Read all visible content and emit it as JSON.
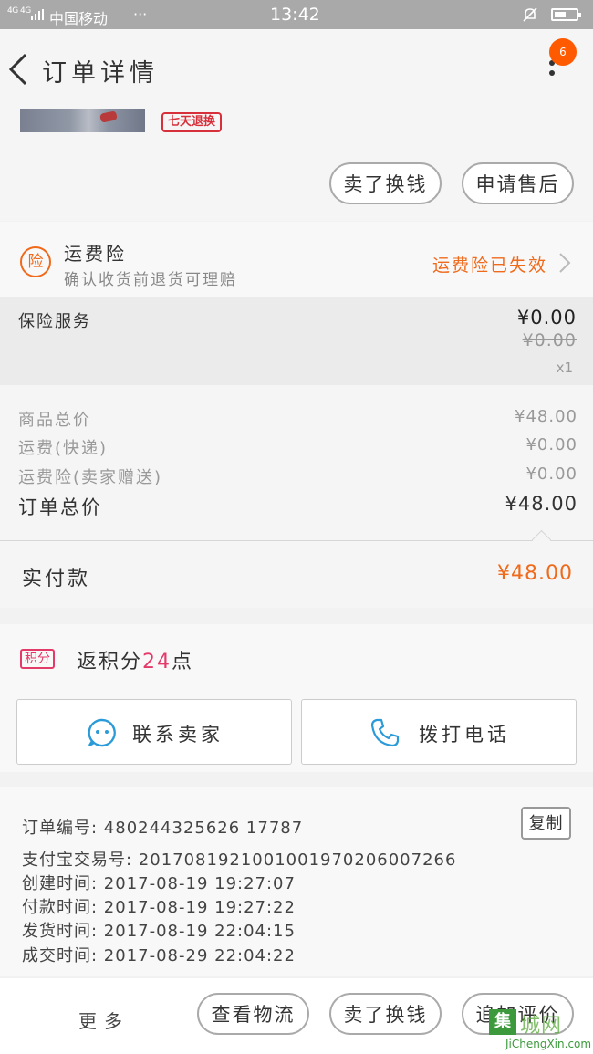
{
  "status_bar": {
    "signal": "4G 4G",
    "carrier": "中国移动",
    "dots": "···",
    "time": "13:42"
  },
  "header": {
    "title": "订单详情",
    "badge": "6"
  },
  "product": {
    "tag": "七天退换"
  },
  "actions_top": {
    "btn1": "卖了换钱",
    "btn2": "申请售后"
  },
  "insurance": {
    "icon_text": "险",
    "title": "运费险",
    "subtitle": "确认收货前退货可理赔",
    "status": "运费险已失效"
  },
  "insurance_service": {
    "label": "保险服务",
    "price": "¥0.00",
    "original_price": "¥0.00",
    "quantity": "x1"
  },
  "totals": {
    "rows": [
      {
        "label": "商品总价",
        "value": "¥48.00"
      },
      {
        "label": "运费(快递)",
        "value": "¥0.00"
      },
      {
        "label": "运费险(卖家赠送)",
        "value": "¥0.00"
      },
      {
        "label": "订单总价",
        "value": "¥48.00"
      }
    ],
    "paid_label": "实付款",
    "paid_value": "¥48.00"
  },
  "points": {
    "tag": "积分",
    "prefix": "返积分",
    "number": "24",
    "suffix": "点"
  },
  "contact": {
    "seller": "联系卖家",
    "phone": "拨打电话"
  },
  "order_info": {
    "lines": [
      "订单编号: 480244325626 17787",
      "支付宝交易号: 2017081921001001970206007266",
      "创建时间: 2017-08-19 19:27:07",
      "付款时间: 2017-08-19 19:27:22",
      "发货时间: 2017-08-19 22:04:15",
      "成交时间: 2017-08-29 22:04:22"
    ],
    "copy": "复制"
  },
  "bottom_bar": {
    "more": "更多",
    "btn1": "查看物流",
    "btn2": "卖了换钱",
    "btn3": "追加评价"
  },
  "watermark": {
    "box": "集",
    "cn": "城网",
    "en": "JiChengXin.com"
  },
  "colors": {
    "accent": "#f06a1c",
    "points": "#e43a6a",
    "phone_icon": "#2a9bd8"
  }
}
